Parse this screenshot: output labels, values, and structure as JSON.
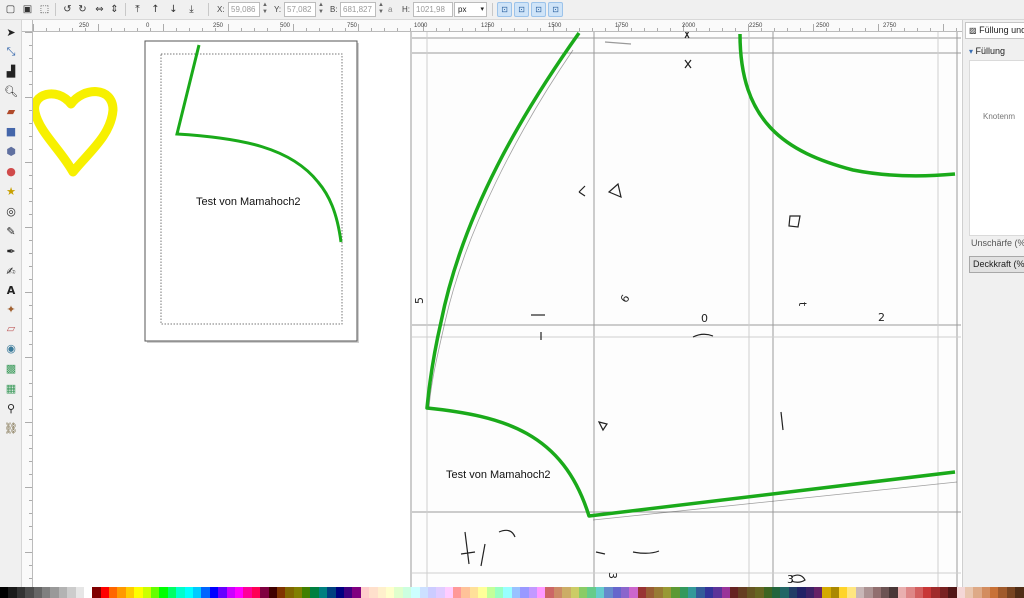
{
  "toolbar": {
    "x_label": "X:",
    "x_value": "59,086",
    "y_label": "Y:",
    "y_value": "57,082",
    "w_label": "B:",
    "w_value": "681,827",
    "lock_symbol": "a",
    "h_label": "H:",
    "h_value": "1021,98",
    "unit": "px"
  },
  "ruler_top_labels": [
    "250",
    "0",
    "250",
    "500",
    "750",
    "1000",
    "1250",
    "1500",
    "1750",
    "2000",
    "2250",
    "2500",
    "2750"
  ],
  "canvas": {
    "small_page_text": "Test von Mamahoch2",
    "big_page_text": "Test von Mamahoch2",
    "handwriting": [
      "5",
      "6",
      "0",
      "t",
      "2",
      "3",
      "3"
    ],
    "stroke_color": "#1aaa1a",
    "heart_color": "#f7f000"
  },
  "panel": {
    "title": "Füllung und",
    "sub_tab": "Füllung",
    "content_label": "Knotenm",
    "blur_label": "Unschärfe (%",
    "opacity_label": "Deckkraft (%"
  },
  "palette_colors": [
    "#000000",
    "#1a1a1a",
    "#333333",
    "#4d4d4d",
    "#666666",
    "#808080",
    "#999999",
    "#b3b3b3",
    "#cccccc",
    "#e6e6e6",
    "#ffffff",
    "#800000",
    "#ff0000",
    "#ff6600",
    "#ff9900",
    "#ffcc00",
    "#ffff00",
    "#ccff00",
    "#66ff00",
    "#00ff00",
    "#00ff66",
    "#00ffcc",
    "#00ffff",
    "#00ccff",
    "#0066ff",
    "#0000ff",
    "#6600ff",
    "#cc00ff",
    "#ff00ff",
    "#ff0099",
    "#ff0055",
    "#800040",
    "#400000",
    "#803300",
    "#806600",
    "#808000",
    "#408000",
    "#008040",
    "#008080",
    "#004080",
    "#000080",
    "#400080",
    "#800080",
    "#ffcccc",
    "#ffe0cc",
    "#fff0cc",
    "#ffffcc",
    "#e0ffcc",
    "#ccffe0",
    "#ccffff",
    "#cce0ff",
    "#ccccff",
    "#e0ccff",
    "#ffccff",
    "#ff9999",
    "#ffc299",
    "#ffe099",
    "#ffff99",
    "#c2ff99",
    "#99ffc2",
    "#99ffff",
    "#99c2ff",
    "#9999ff",
    "#c299ff",
    "#ff99ff",
    "#cc6666",
    "#cc8a66",
    "#ccad66",
    "#cccc66",
    "#8acc66",
    "#66cc8a",
    "#66cccc",
    "#668acc",
    "#6666cc",
    "#8a66cc",
    "#cc66cc",
    "#993333",
    "#995c33",
    "#997a33",
    "#999933",
    "#5c9933",
    "#33995c",
    "#339999",
    "#335c99",
    "#333399",
    "#5c3399",
    "#993399",
    "#662222",
    "#663d22",
    "#665522",
    "#666622",
    "#3d6622",
    "#22663d",
    "#226666",
    "#223d66",
    "#222266",
    "#3d2266",
    "#662266",
    "#d4aa00",
    "#aa8800",
    "#ffd42a",
    "#ffe680",
    "#c8b7b7",
    "#ac9393",
    "#916f6f",
    "#6c5353",
    "#483737",
    "#e9afaf",
    "#de8787",
    "#d35f5f",
    "#c83737",
    "#a02c2c",
    "#782121",
    "#501616",
    "#f4d7d7",
    "#e9c6af",
    "#deaa87",
    "#d38d5f",
    "#c87137",
    "#a05a2c",
    "#784421",
    "#502d16"
  ]
}
